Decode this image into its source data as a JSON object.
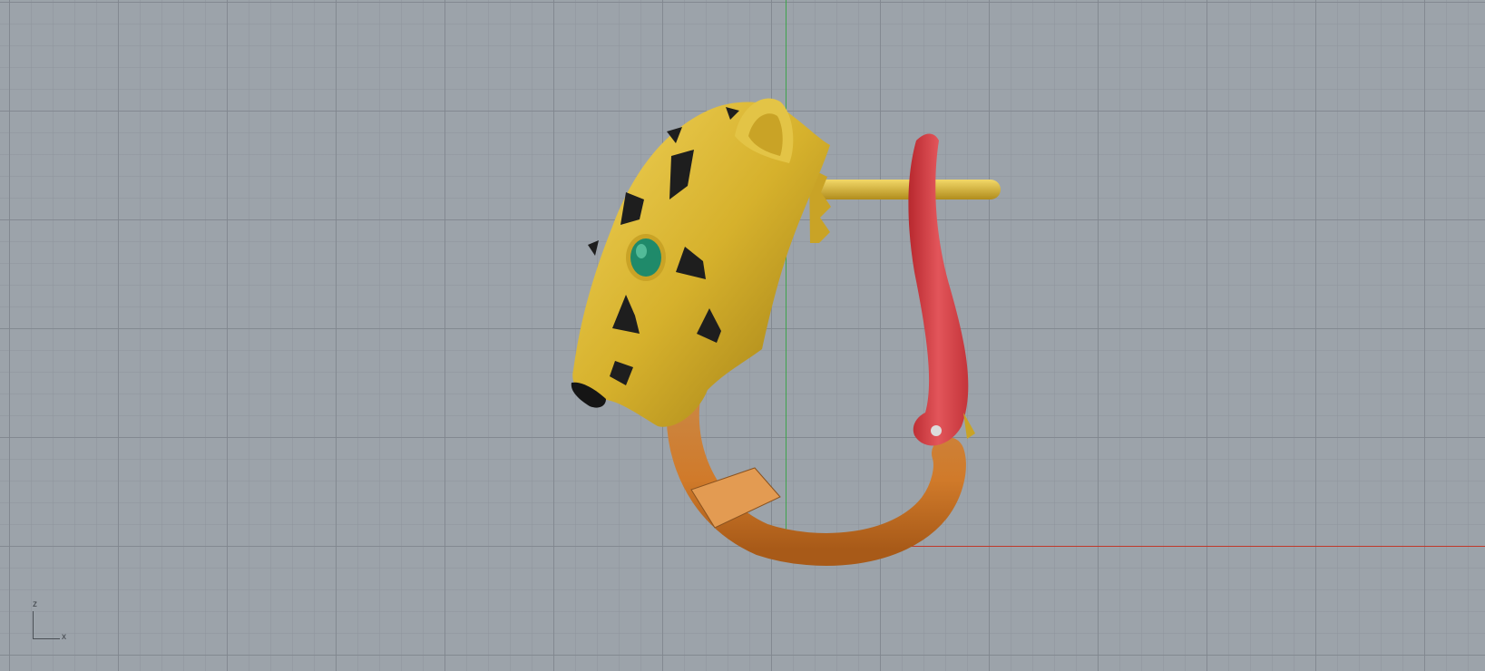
{
  "viewport": {
    "axis_labels": {
      "vertical": "z",
      "horizontal": "x"
    }
  },
  "colors": {
    "grid_background": "#9ca3aa",
    "gold": "#d4b12c",
    "spots": "#1e1e1e",
    "emerald": "#1f8a6a",
    "clasp_red": "#d9434a",
    "hoop_copper": "#cf7a2e",
    "axis_green": "#3fa34d",
    "axis_red": "#c0392b"
  },
  "icons": {
    "axis_triad": "axis-triad-icon"
  }
}
